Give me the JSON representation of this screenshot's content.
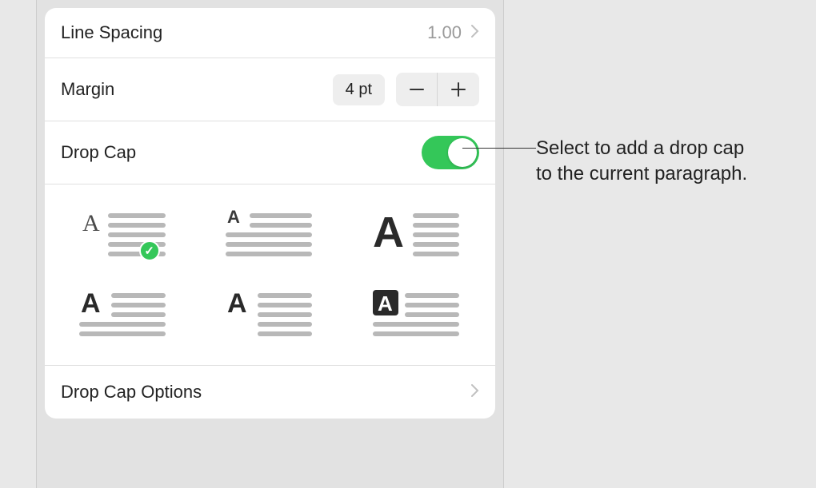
{
  "settings": {
    "lineSpacing": {
      "label": "Line Spacing",
      "value": "1.00"
    },
    "margin": {
      "label": "Margin",
      "value": "4 pt"
    },
    "dropCap": {
      "label": "Drop Cap",
      "enabled": true
    },
    "dropCapOptions": {
      "label": "Drop Cap Options"
    },
    "styles": [
      {
        "name": "dropcap-raised-small",
        "selected": true
      },
      {
        "name": "dropcap-inline-small",
        "selected": false
      },
      {
        "name": "dropcap-large-bold",
        "selected": false
      },
      {
        "name": "dropcap-full-left",
        "selected": false
      },
      {
        "name": "dropcap-indent",
        "selected": false
      },
      {
        "name": "dropcap-boxed",
        "selected": false
      }
    ]
  },
  "callout": {
    "line1": "Select to add a drop cap",
    "line2": "to the current paragraph."
  }
}
